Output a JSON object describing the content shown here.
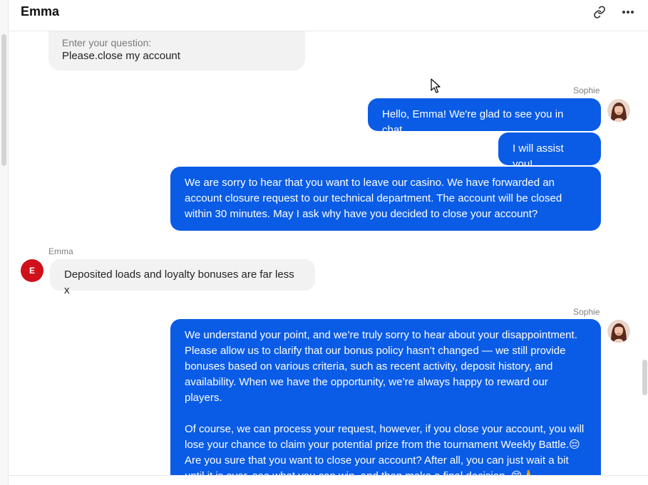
{
  "header": {
    "title": "Emma",
    "link_icon": "link-icon",
    "more_icon": "more-horizontal-icon"
  },
  "form": {
    "label": "Enter your question:",
    "value": "Please.close my account"
  },
  "agent": {
    "name": "Sophie",
    "avatar_icon": "agent-avatar-photo"
  },
  "user": {
    "name": "Emma",
    "initial": "E",
    "avatar_color": "#d0101a"
  },
  "colors": {
    "agent_bubble": "#0a5ce6",
    "user_bubble": "#f2f2f2"
  },
  "messages": {
    "m1": "Hello, Emma! We're glad to see you in chat.",
    "m2": "I will assist you!",
    "m3": "We are sorry to hear that you want to leave our casino. We have forwarded an account closure request to our technical department. The account will be closed within 30 minutes. May I ask why have you decided to close your account?",
    "u1": "Deposited loads and loyalty bonuses are far less x",
    "m4_p1": "We understand your point, and we’re truly sorry to hear about your disappointment. Please allow us to clarify that our bonus policy hasn’t changed — we still provide bonuses based on various criteria, such as recent activity, deposit history, and availability. When we have the opportunity, we’re always happy to reward our players.",
    "m4_p2": "Of course, we can process your request, however, if you close your account, you will lose your chance to claim your potential prize from the tournament Weekly Battle.😔 Are you sure that you want to close your account? After all, you can just wait a bit until it is over, see what you can win, and then make a final decision. 😊🙏"
  }
}
